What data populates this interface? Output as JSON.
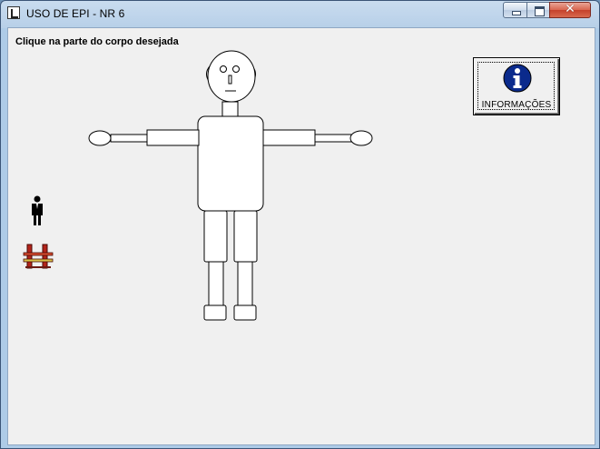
{
  "window": {
    "title": "USO DE EPI - NR 6"
  },
  "titlebar_controls": {
    "close_glyph": "✕"
  },
  "main": {
    "instruction": "Clique na parte do corpo desejada",
    "info_button": {
      "label": "INFORMAÇÕES",
      "icon": "info-icon",
      "icon_color": "#0a2a8c"
    },
    "side_icons": [
      {
        "name": "person-icon"
      },
      {
        "name": "railing-icon",
        "color": "#b3241b"
      }
    ]
  }
}
